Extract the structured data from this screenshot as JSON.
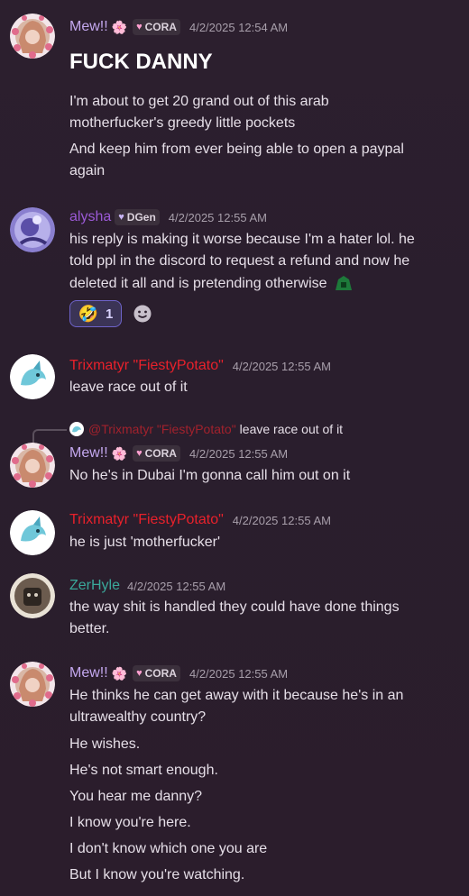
{
  "colors": {
    "mew": "#c4a8ef",
    "alysha": "#9b59d6",
    "trix": "#e8212b",
    "zer": "#3aa89a"
  },
  "messages": [
    {
      "username": "Mew!!",
      "badge": "CORA",
      "timestamp": "4/2/2025 12:54 AM",
      "lines": [
        "FUCK DANNY",
        "I'm about to get 20 grand out of this arab",
        "motherfucker's greedy little pockets",
        "And keep him from ever being able to open a paypal",
        "again"
      ]
    },
    {
      "username": "alysha",
      "badge": "DGen",
      "timestamp": "4/2/2025 12:55 AM",
      "lines": [
        "his reply is making it worse because I'm a hater lol. he",
        "told ppl in the discord to request a refund and now he",
        "deleted it all and is pretending otherwise"
      ],
      "reaction_count": "1"
    },
    {
      "username": "Trixmatyr \"FiestyPotato\"",
      "timestamp": "4/2/2025 12:55 AM",
      "lines": [
        "leave race out of it"
      ]
    },
    {
      "reply_to_user": "@Trixmatyr \"FiestyPotato\"",
      "reply_to_text": "leave race out of it",
      "username": "Mew!!",
      "badge": "CORA",
      "timestamp": "4/2/2025 12:55 AM",
      "lines": [
        "No he's in Dubai I'm gonna call him out on it"
      ]
    },
    {
      "username": "Trixmatyr \"FiestyPotato\"",
      "timestamp": "4/2/2025 12:55 AM",
      "lines": [
        "he is just 'motherfucker'"
      ]
    },
    {
      "username": "ZerHyle",
      "timestamp": "4/2/2025 12:55 AM",
      "lines": [
        "the way shit is handled they could have done things",
        "better."
      ]
    },
    {
      "username": "Mew!!",
      "badge": "CORA",
      "timestamp": "4/2/2025 12:55 AM",
      "lines": [
        "He thinks he can get away with it because he's in an",
        "ultrawealthy country?",
        "He wishes.",
        "He's not smart enough.",
        "You hear me danny?",
        "I know you're here.",
        "I don't know which one you are",
        "But I know you're watching."
      ]
    }
  ]
}
